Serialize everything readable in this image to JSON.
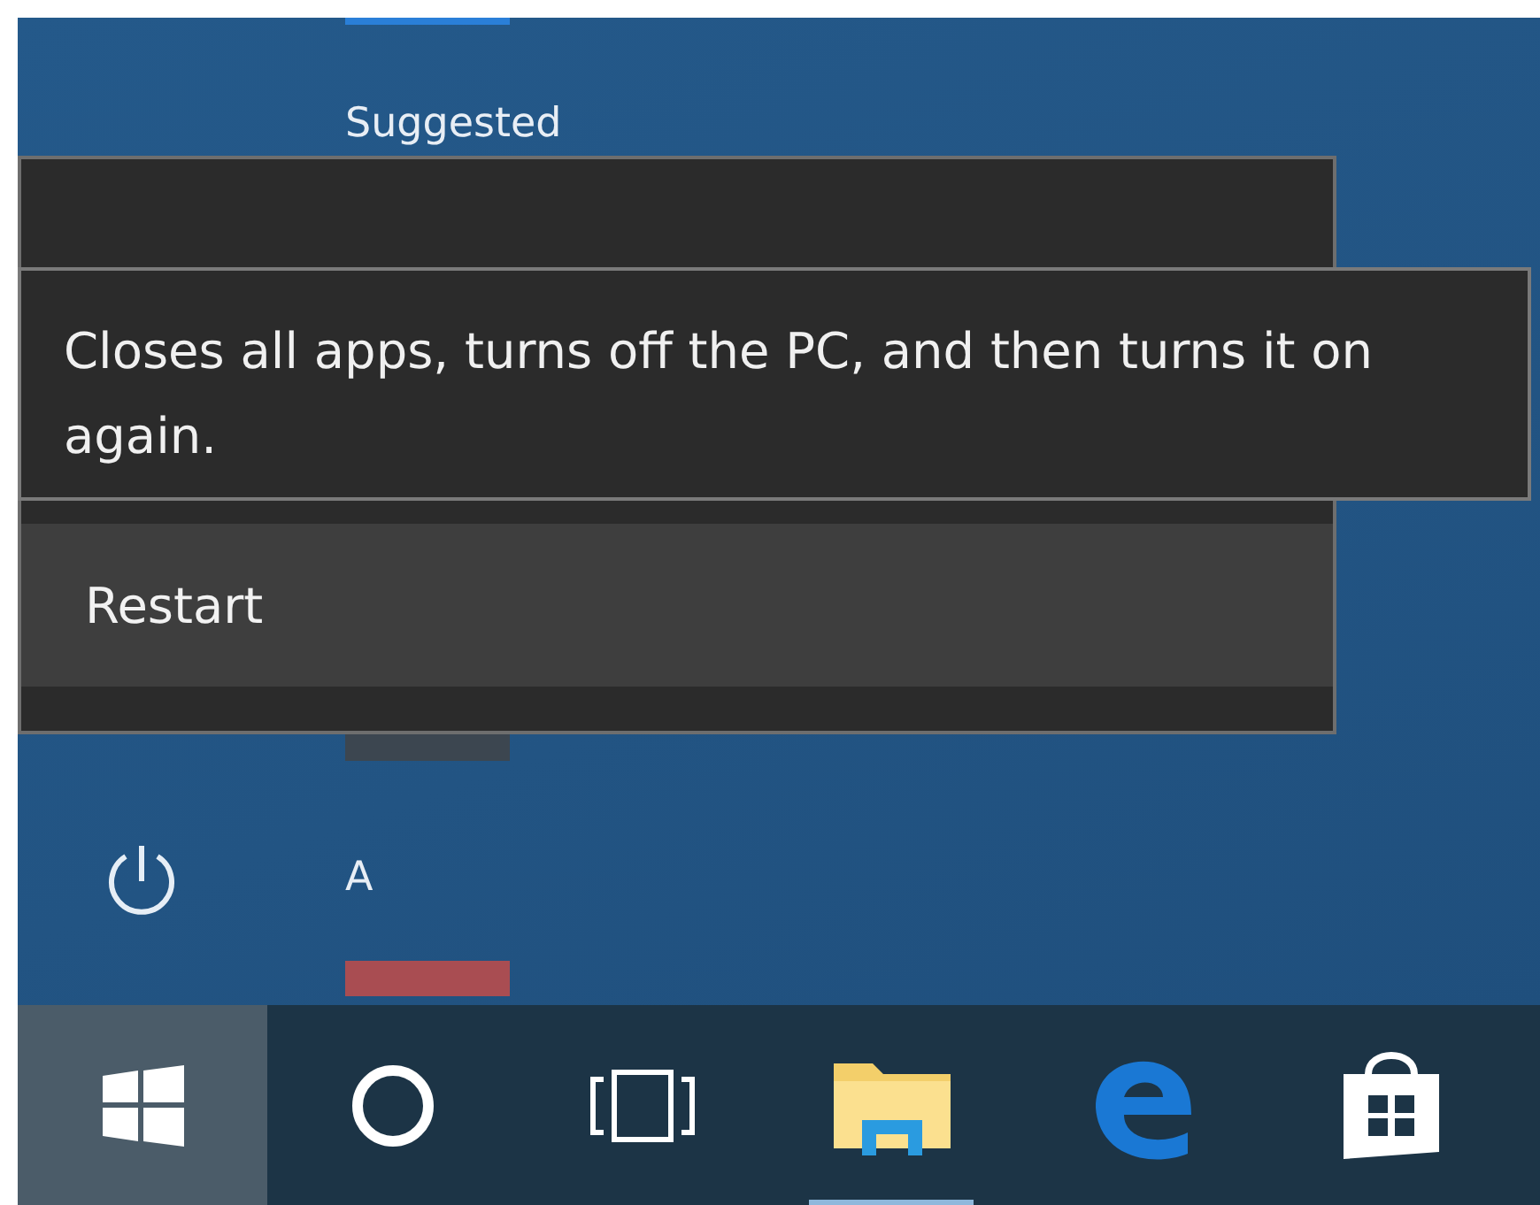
{
  "start_menu": {
    "section_heading": "Suggested",
    "letter_heading": "A"
  },
  "power_menu": {
    "items": [
      {
        "label": "Restart",
        "selected": true
      }
    ]
  },
  "tooltip": {
    "text": "Closes all apps, turns off the PC, and then turns it on again."
  },
  "taskbar": {
    "items": [
      {
        "kind": "start",
        "selected": true,
        "running": false
      },
      {
        "kind": "search",
        "selected": false,
        "running": false
      },
      {
        "kind": "task-view",
        "selected": false,
        "running": false
      },
      {
        "kind": "file-explorer",
        "selected": false,
        "running": true
      },
      {
        "kind": "edge",
        "selected": false,
        "running": false
      },
      {
        "kind": "store",
        "selected": false,
        "running": false
      }
    ]
  }
}
